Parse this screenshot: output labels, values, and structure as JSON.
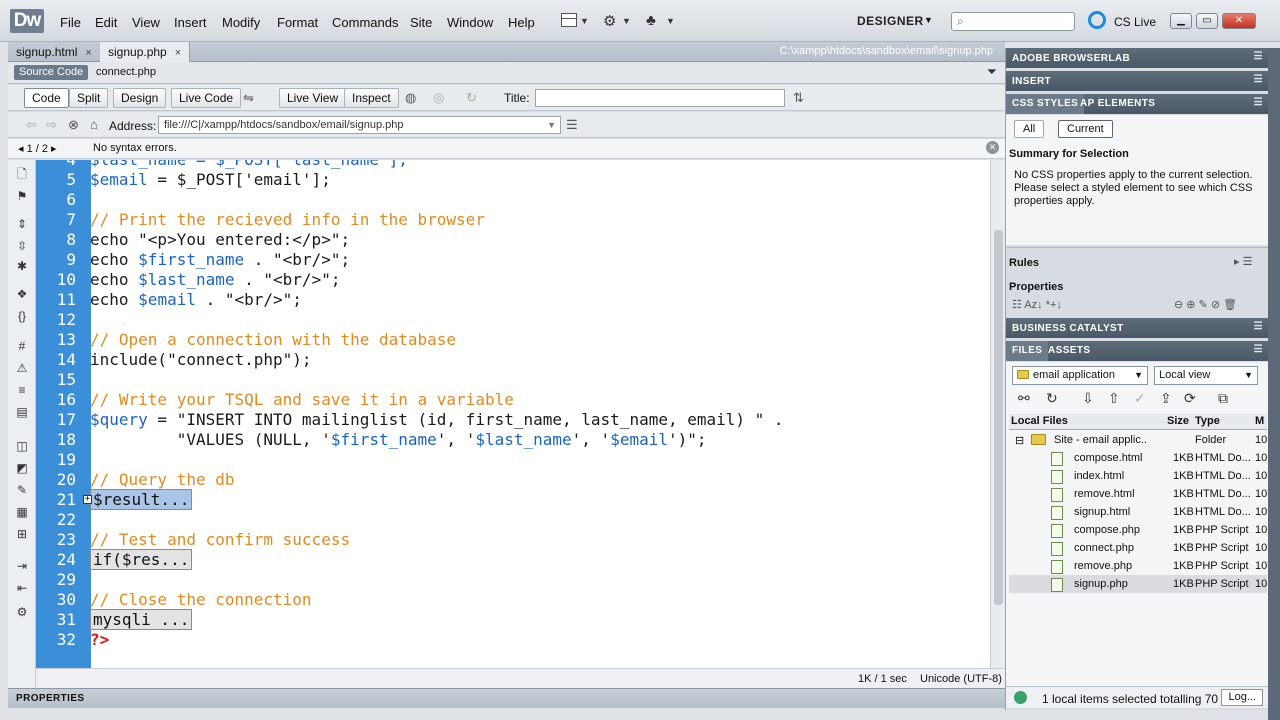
{
  "app": {
    "logo": "Dw",
    "menus": [
      "File",
      "Edit",
      "View",
      "Insert",
      "Modify",
      "Format",
      "Commands",
      "Site",
      "Window",
      "Help"
    ],
    "workspace": "DESIGNER",
    "cslive": "CS Live",
    "search_placeholder": ""
  },
  "document": {
    "tabs": [
      {
        "label": "signup.html",
        "close": "×"
      },
      {
        "label": "signup.php",
        "close": "×"
      }
    ],
    "filepath": "C:\\xampp\\htdocs\\sandbox\\email\\signup.php",
    "source_code": "Source Code",
    "related_file": "connect.php",
    "toolbar": {
      "code": "Code",
      "split": "Split",
      "design": "Design",
      "live_code": "Live Code",
      "live_view": "Live View",
      "inspect": "Inspect",
      "title_label": "Title:",
      "title_value": ""
    },
    "address_label": "Address:",
    "address_value": "file:///C|/xampp/htdocs/sandbox/email/signup.php",
    "error_nav": "1 / 2",
    "error_msg": "No syntax errors.",
    "status_size": "1K / 1 sec",
    "status_encoding": "Unicode (UTF-8)",
    "properties": "PROPERTIES"
  },
  "code_lines": [
    {
      "n": "4",
      "parts": [
        {
          "t": "$last_name = $_POST['last_name'];",
          "c": "c-var"
        }
      ]
    },
    {
      "n": "5",
      "parts": [
        {
          "t": "$email",
          "c": "c-var"
        },
        {
          "t": " = $_POST['email'];",
          "c": "c-kw"
        }
      ]
    },
    {
      "n": "6",
      "parts": []
    },
    {
      "n": "7",
      "parts": [
        {
          "t": "// Print the recieved info in the browser",
          "c": "c-com"
        }
      ]
    },
    {
      "n": "8",
      "parts": [
        {
          "t": "echo \"<p>You entered:</p>\";",
          "c": "c-kw"
        }
      ]
    },
    {
      "n": "9",
      "parts": [
        {
          "t": "echo ",
          "c": "c-kw"
        },
        {
          "t": "$first_name",
          "c": "c-var"
        },
        {
          "t": " . \"<br/>\";",
          "c": "c-kw"
        }
      ]
    },
    {
      "n": "10",
      "parts": [
        {
          "t": "echo ",
          "c": "c-kw"
        },
        {
          "t": "$last_name",
          "c": "c-var"
        },
        {
          "t": " . \"<br/>\";",
          "c": "c-kw"
        }
      ]
    },
    {
      "n": "11",
      "parts": [
        {
          "t": "echo ",
          "c": "c-kw"
        },
        {
          "t": "$email",
          "c": "c-var"
        },
        {
          "t": " . \"<br/>\";",
          "c": "c-kw"
        }
      ]
    },
    {
      "n": "12",
      "parts": []
    },
    {
      "n": "13",
      "parts": [
        {
          "t": "// Open a connection with the database",
          "c": "c-com"
        }
      ]
    },
    {
      "n": "14",
      "parts": [
        {
          "t": "include(\"connect.php\");",
          "c": "c-kw"
        }
      ]
    },
    {
      "n": "15",
      "parts": []
    },
    {
      "n": "16",
      "parts": [
        {
          "t": "// Write your TSQL and save it in a variable",
          "c": "c-com"
        }
      ]
    },
    {
      "n": "17",
      "parts": [
        {
          "t": "$query",
          "c": "c-var"
        },
        {
          "t": " = \"INSERT INTO mailinglist (id, first_name, last_name, email) \" .",
          "c": "c-kw"
        }
      ]
    },
    {
      "n": "18",
      "parts": [
        {
          "t": "         \"VALUES (NULL, '",
          "c": "c-kw"
        },
        {
          "t": "$first_name",
          "c": "c-var"
        },
        {
          "t": "', '",
          "c": "c-kw"
        },
        {
          "t": "$last_name",
          "c": "c-var"
        },
        {
          "t": "', '",
          "c": "c-kw"
        },
        {
          "t": "$email",
          "c": "c-var"
        },
        {
          "t": "')\";",
          "c": "c-kw"
        }
      ]
    },
    {
      "n": "19",
      "parts": []
    },
    {
      "n": "20",
      "parts": [
        {
          "t": "// Query the db",
          "c": "c-com"
        }
      ]
    },
    {
      "n": "21",
      "parts": [
        {
          "t": "$result...",
          "c": "collapsed sel"
        }
      ]
    },
    {
      "n": "22",
      "parts": []
    },
    {
      "n": "23",
      "parts": [
        {
          "t": "// Test and confirm success",
          "c": "c-com"
        }
      ]
    },
    {
      "n": "24",
      "parts": [
        {
          "t": "if($res...",
          "c": "collapsed"
        }
      ]
    },
    {
      "n": "29",
      "parts": []
    },
    {
      "n": "30",
      "parts": [
        {
          "t": "// Close the connection",
          "c": "c-com"
        }
      ]
    },
    {
      "n": "31",
      "parts": [
        {
          "t": "mysqli ...",
          "c": "collapsed"
        }
      ]
    },
    {
      "n": "32",
      "parts": [
        {
          "t": "?>",
          "c": "c-php"
        }
      ]
    }
  ],
  "panels": {
    "browserlab": "ADOBE BROWSERLAB",
    "insert": "INSERT",
    "css_styles": "CSS STYLES",
    "ap_elements": "AP ELEMENTS",
    "all": "All",
    "current": "Current",
    "summary_title": "Summary for Selection",
    "summary_text": "No CSS properties apply to the current selection. Please select a styled element to see which CSS properties apply.",
    "rules": "Rules",
    "properties": "Properties",
    "business_catalyst": "BUSINESS CATALYST",
    "files_tab": "FILES",
    "assets_tab": "ASSETS",
    "site_select": "email application",
    "view_select": "Local view",
    "col_local": "Local Files",
    "col_size": "Size",
    "col_type": "Type",
    "col_mod": "M",
    "files": [
      {
        "name": "Site - email applic...",
        "size": "",
        "type": "Folder",
        "mod": "10",
        "folder": true
      },
      {
        "name": "compose.html",
        "size": "1KB",
        "type": "HTML Do...",
        "mod": "10"
      },
      {
        "name": "index.html",
        "size": "1KB",
        "type": "HTML Do...",
        "mod": "10"
      },
      {
        "name": "remove.html",
        "size": "1KB",
        "type": "HTML Do...",
        "mod": "10"
      },
      {
        "name": "signup.html",
        "size": "1KB",
        "type": "HTML Do...",
        "mod": "10"
      },
      {
        "name": "compose.php",
        "size": "1KB",
        "type": "PHP Script",
        "mod": "10"
      },
      {
        "name": "connect.php",
        "size": "1KB",
        "type": "PHP Script",
        "mod": "10"
      },
      {
        "name": "remove.php",
        "size": "1KB",
        "type": "PHP Script",
        "mod": "10"
      },
      {
        "name": "signup.php",
        "size": "1KB",
        "type": "PHP Script",
        "mod": "10",
        "selected": true
      }
    ],
    "files_status": "1 local items selected totalling 70",
    "log_button": "Log..."
  }
}
